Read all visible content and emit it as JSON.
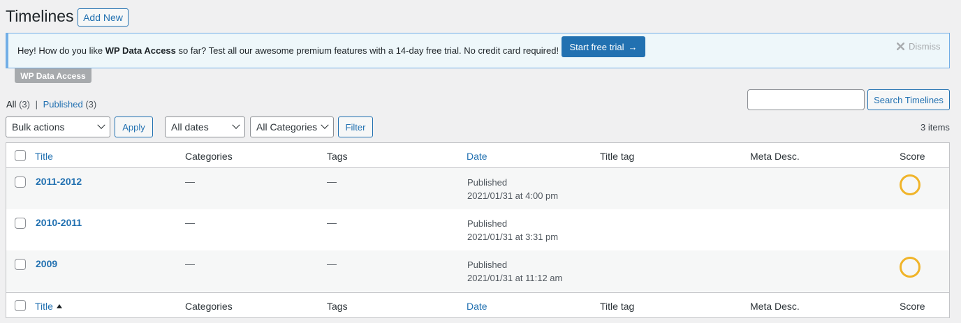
{
  "page": {
    "title": "Timelines",
    "add_new": "Add New"
  },
  "notice": {
    "text_before": "Hey! How do you like ",
    "text_bold": "WP Data Access",
    "text_after": " so far? Test all our awesome premium features with a 14-day free trial. No credit card required!",
    "cta_label": "Start free trial",
    "cta_arrow": "→",
    "dismiss_label": "Dismiss",
    "tag": "WP Data Access"
  },
  "views": {
    "all_label": "All",
    "all_count": "(3)",
    "separator": "|",
    "published_label": "Published",
    "published_count": "(3)"
  },
  "search": {
    "value": "",
    "button": "Search Timelines"
  },
  "filters": {
    "bulk_actions": "Bulk actions",
    "apply": "Apply",
    "dates": "All dates",
    "categories": "All Categories",
    "filter": "Filter",
    "items_count": "3 items"
  },
  "columns": [
    "Title",
    "Categories",
    "Tags",
    "Date",
    "Title tag",
    "Meta Desc.",
    "Score"
  ],
  "rows": [
    {
      "title": "2011-2012",
      "categories": "—",
      "tags": "—",
      "status": "Published",
      "date": "2021/01/31 at 4:00 pm",
      "score_icon": "score-circle"
    },
    {
      "title": "2010-2011",
      "categories": "—",
      "tags": "—",
      "status": "Published",
      "date": "2021/01/31 at 3:31 pm",
      "score_icon": ""
    },
    {
      "title": "2009",
      "categories": "—",
      "tags": "—",
      "status": "Published",
      "date": "2021/01/31 at 11:12 am",
      "score_icon": "score-circle"
    }
  ],
  "colors": {
    "accent": "#2271b1",
    "score": "#f0b429"
  }
}
